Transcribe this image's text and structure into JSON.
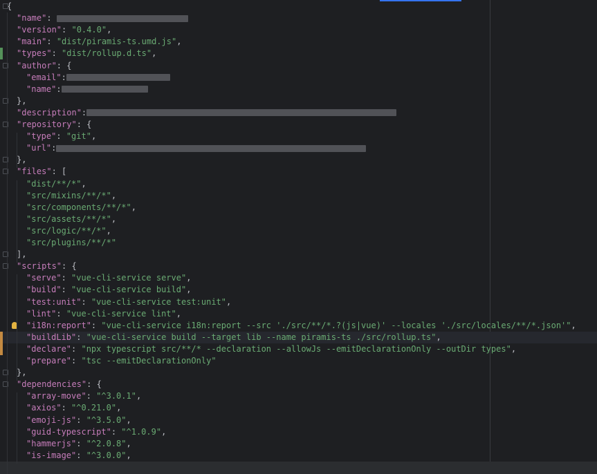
{
  "colors": {
    "key": "#c77dbb",
    "string": "#6aab73",
    "punct": "#bcbec4",
    "background": "#1e1f22"
  },
  "lines": [
    {
      "parts": [
        [
          "p",
          "{"
        ]
      ]
    },
    {
      "parts": [
        [
          "k",
          "\"name\""
        ],
        [
          "p",
          ": "
        ],
        [
          "r",
          "190"
        ]
      ]
    },
    {
      "parts": [
        [
          "k",
          "\"version\""
        ],
        [
          "p",
          ": "
        ],
        [
          "s",
          "\"0.4.0\""
        ],
        [
          "p",
          ","
        ]
      ]
    },
    {
      "parts": [
        [
          "k",
          "\"main\""
        ],
        [
          "p",
          ": "
        ],
        [
          "s",
          "\"dist/piramis-ts.umd.js\""
        ],
        [
          "p",
          ","
        ]
      ]
    },
    {
      "parts": [
        [
          "k",
          "\"types\""
        ],
        [
          "p",
          ": "
        ],
        [
          "s",
          "\"dist/rollup.d.ts\""
        ],
        [
          "p",
          ","
        ]
      ]
    },
    {
      "parts": [
        [
          "k",
          "\"author\""
        ],
        [
          "p",
          ": {"
        ]
      ]
    },
    {
      "parts": [
        [
          "k",
          "\"email\""
        ],
        [
          "p",
          ":"
        ],
        [
          "r",
          "150"
        ]
      ]
    },
    {
      "parts": [
        [
          "k",
          "\"name\""
        ],
        [
          "p",
          ":"
        ],
        [
          "r",
          "125"
        ]
      ]
    },
    {
      "parts": [
        [
          "p",
          "},"
        ]
      ]
    },
    {
      "parts": [
        [
          "k",
          "\"description\""
        ],
        [
          "p",
          ":"
        ],
        [
          "r",
          "448"
        ]
      ]
    },
    {
      "parts": [
        [
          "k",
          "\"repository\""
        ],
        [
          "p",
          ": {"
        ]
      ]
    },
    {
      "parts": [
        [
          "k",
          "\"type\""
        ],
        [
          "p",
          ": "
        ],
        [
          "s",
          "\"git\""
        ],
        [
          "p",
          ","
        ]
      ]
    },
    {
      "parts": [
        [
          "k",
          "\"url\""
        ],
        [
          "p",
          ":"
        ],
        [
          "r",
          "448"
        ]
      ]
    },
    {
      "parts": [
        [
          "p",
          "},"
        ]
      ]
    },
    {
      "parts": [
        [
          "k",
          "\"files\""
        ],
        [
          "p",
          ": ["
        ]
      ]
    },
    {
      "parts": [
        [
          "s",
          "\"dist/**/*\""
        ],
        [
          "p",
          ","
        ]
      ]
    },
    {
      "parts": [
        [
          "s",
          "\"src/mixins/**/*\""
        ],
        [
          "p",
          ","
        ]
      ]
    },
    {
      "parts": [
        [
          "s",
          "\"src/components/**/*\""
        ],
        [
          "p",
          ","
        ]
      ]
    },
    {
      "parts": [
        [
          "s",
          "\"src/assets/**/*\""
        ],
        [
          "p",
          ","
        ]
      ]
    },
    {
      "parts": [
        [
          "s",
          "\"src/logic/**/*\""
        ],
        [
          "p",
          ","
        ]
      ]
    },
    {
      "parts": [
        [
          "s",
          "\"src/plugins/**/*\""
        ]
      ]
    },
    {
      "parts": [
        [
          "p",
          "],"
        ]
      ]
    },
    {
      "parts": [
        [
          "k",
          "\"scripts\""
        ],
        [
          "p",
          ": {"
        ]
      ]
    },
    {
      "parts": [
        [
          "k",
          "\"serve\""
        ],
        [
          "p",
          ": "
        ],
        [
          "s",
          "\"vue-cli-service serve\""
        ],
        [
          "p",
          ","
        ]
      ]
    },
    {
      "parts": [
        [
          "k",
          "\"build\""
        ],
        [
          "p",
          ": "
        ],
        [
          "s",
          "\"vue-cli-service build\""
        ],
        [
          "p",
          ","
        ]
      ]
    },
    {
      "parts": [
        [
          "k",
          "\"test:unit\""
        ],
        [
          "p",
          ": "
        ],
        [
          "s",
          "\"vue-cli-service test:unit\""
        ],
        [
          "p",
          ","
        ]
      ]
    },
    {
      "parts": [
        [
          "k",
          "\"lint\""
        ],
        [
          "p",
          ": "
        ],
        [
          "s",
          "\"vue-cli-service lint\""
        ],
        [
          "p",
          ","
        ]
      ]
    },
    {
      "parts": [
        [
          "k",
          "\"i18n:report\""
        ],
        [
          "p",
          ": "
        ],
        [
          "s",
          "\"vue-cli-service i18n:report --src './src/**/*.?(js|vue)' --locales './src/locales/**/*.json'\""
        ],
        [
          "p",
          ","
        ]
      ]
    },
    {
      "parts": [
        [
          "k",
          "\"buildLib\""
        ],
        [
          "p",
          ": "
        ],
        [
          "s",
          "\"vue-cli-service build --target lib --name piramis-ts ./src/rollup.ts\""
        ],
        [
          "p",
          ","
        ]
      ]
    },
    {
      "parts": [
        [
          "k",
          "\"declare\""
        ],
        [
          "p",
          ": "
        ],
        [
          "s",
          "\"npx typescript src/**/* --declaration --allowJs --emitDeclarationOnly --outDir types\""
        ],
        [
          "p",
          ","
        ]
      ]
    },
    {
      "parts": [
        [
          "k",
          "\"prepare\""
        ],
        [
          "p",
          ": "
        ],
        [
          "s",
          "\"tsc --emitDeclarationOnly\""
        ]
      ]
    },
    {
      "parts": [
        [
          "p",
          "},"
        ]
      ]
    },
    {
      "parts": [
        [
          "k",
          "\"dependencies\""
        ],
        [
          "p",
          ": {"
        ]
      ]
    },
    {
      "parts": [
        [
          "k",
          "\"array-move\""
        ],
        [
          "p",
          ": "
        ],
        [
          "s",
          "\"^3.0.1\""
        ],
        [
          "p",
          ","
        ]
      ]
    },
    {
      "parts": [
        [
          "k",
          "\"axios\""
        ],
        [
          "p",
          ": "
        ],
        [
          "s",
          "\"^0.21.0\""
        ],
        [
          "p",
          ","
        ]
      ]
    },
    {
      "parts": [
        [
          "k",
          "\"emoji-js\""
        ],
        [
          "p",
          ": "
        ],
        [
          "s",
          "\"^3.5.0\""
        ],
        [
          "p",
          ","
        ]
      ]
    },
    {
      "parts": [
        [
          "k",
          "\"guid-typescript\""
        ],
        [
          "p",
          ": "
        ],
        [
          "s",
          "\"^1.0.9\""
        ],
        [
          "p",
          ","
        ]
      ]
    },
    {
      "parts": [
        [
          "k",
          "\"hammerjs\""
        ],
        [
          "p",
          ": "
        ],
        [
          "s",
          "\"^2.0.8\""
        ],
        [
          "p",
          ","
        ]
      ]
    },
    {
      "parts": [
        [
          "k",
          "\"is-image\""
        ],
        [
          "p",
          ": "
        ],
        [
          "s",
          "\"^3.0.0\""
        ],
        [
          "p",
          ","
        ]
      ]
    }
  ]
}
